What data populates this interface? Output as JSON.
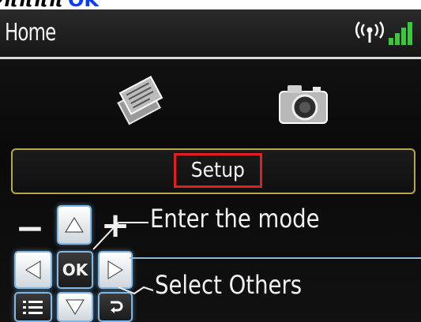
{
  "top_strip": {
    "text": "⁄ππππ",
    "ok_text": "OK"
  },
  "header": {
    "title": "Home",
    "wifi_icon": "wifi-icon",
    "signal_icon": "signal-strength-icon"
  },
  "modes": [
    {
      "name": "copy-icon"
    },
    {
      "name": "photo-camera-icon"
    }
  ],
  "selected_mode": {
    "label": "Setup"
  },
  "controls": {
    "minus": "−",
    "plus": "+",
    "ok": "OK"
  },
  "callouts": {
    "enter": "Enter the mode",
    "select": "Select Others"
  },
  "colors": {
    "highlight_border": "#e02020",
    "band_border": "#b8a642",
    "key_border": "#7fb8e6",
    "signal_green": "#3cc83c"
  }
}
